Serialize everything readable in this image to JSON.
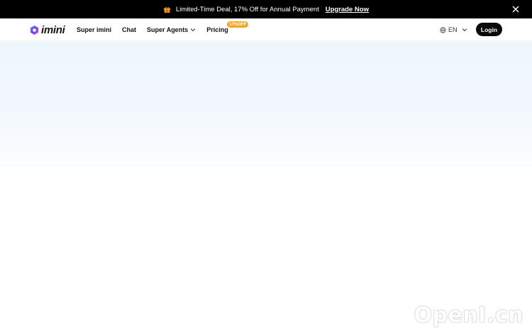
{
  "promo": {
    "text": "Limited-Time Deal, 17% Off for Annual Payment",
    "link_label": "Upgrade Now",
    "gift_icon": "gift-icon",
    "close_icon": "close-icon"
  },
  "brand": {
    "name": "imini",
    "logo_colors": [
      "#7b3ff2",
      "#3b8bff",
      "#e94dd1"
    ]
  },
  "nav": {
    "items": [
      {
        "label": "Super imini"
      },
      {
        "label": "Chat"
      },
      {
        "label": "Super Agents",
        "has_dropdown": true
      },
      {
        "label": "Pricing",
        "badge": "17%OFF"
      }
    ]
  },
  "language": {
    "value": "EN",
    "icon": "globe-icon"
  },
  "auth": {
    "login_label": "Login"
  },
  "watermark": {
    "text": "OpenI.cn"
  },
  "colors": {
    "promo_bg": "#000000",
    "badge": "#f5a623",
    "login_bg": "#0a0a0a",
    "hero_tint": "#eef6fd"
  }
}
